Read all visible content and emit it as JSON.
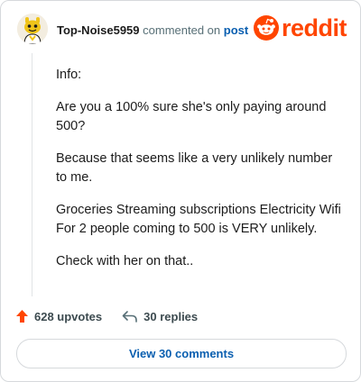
{
  "comment": {
    "username": "Top-Noise5959",
    "commented_on_text": "commented on",
    "post_link": "post",
    "paragraphs": [
      "Info:",
      "Are you a 100% sure she's only paying around 500?",
      "Because that seems like a very unlikely number to me.",
      "Groceries Streaming subscriptions Electricity Wifi For 2 people coming to 500 is VERY unlikely.",
      "Check with her on that.."
    ]
  },
  "brand": {
    "logo_text": "reddit",
    "color": "#ff4500"
  },
  "actions": {
    "upvotes": "628 upvotes",
    "replies": "30 replies",
    "view_comments": "View 30 comments"
  },
  "icons": {
    "avatar": "snoo-avatar-icon",
    "logo": "reddit-snoo-icon",
    "upvote": "upvote-arrow-icon",
    "reply": "reply-arrow-icon"
  }
}
